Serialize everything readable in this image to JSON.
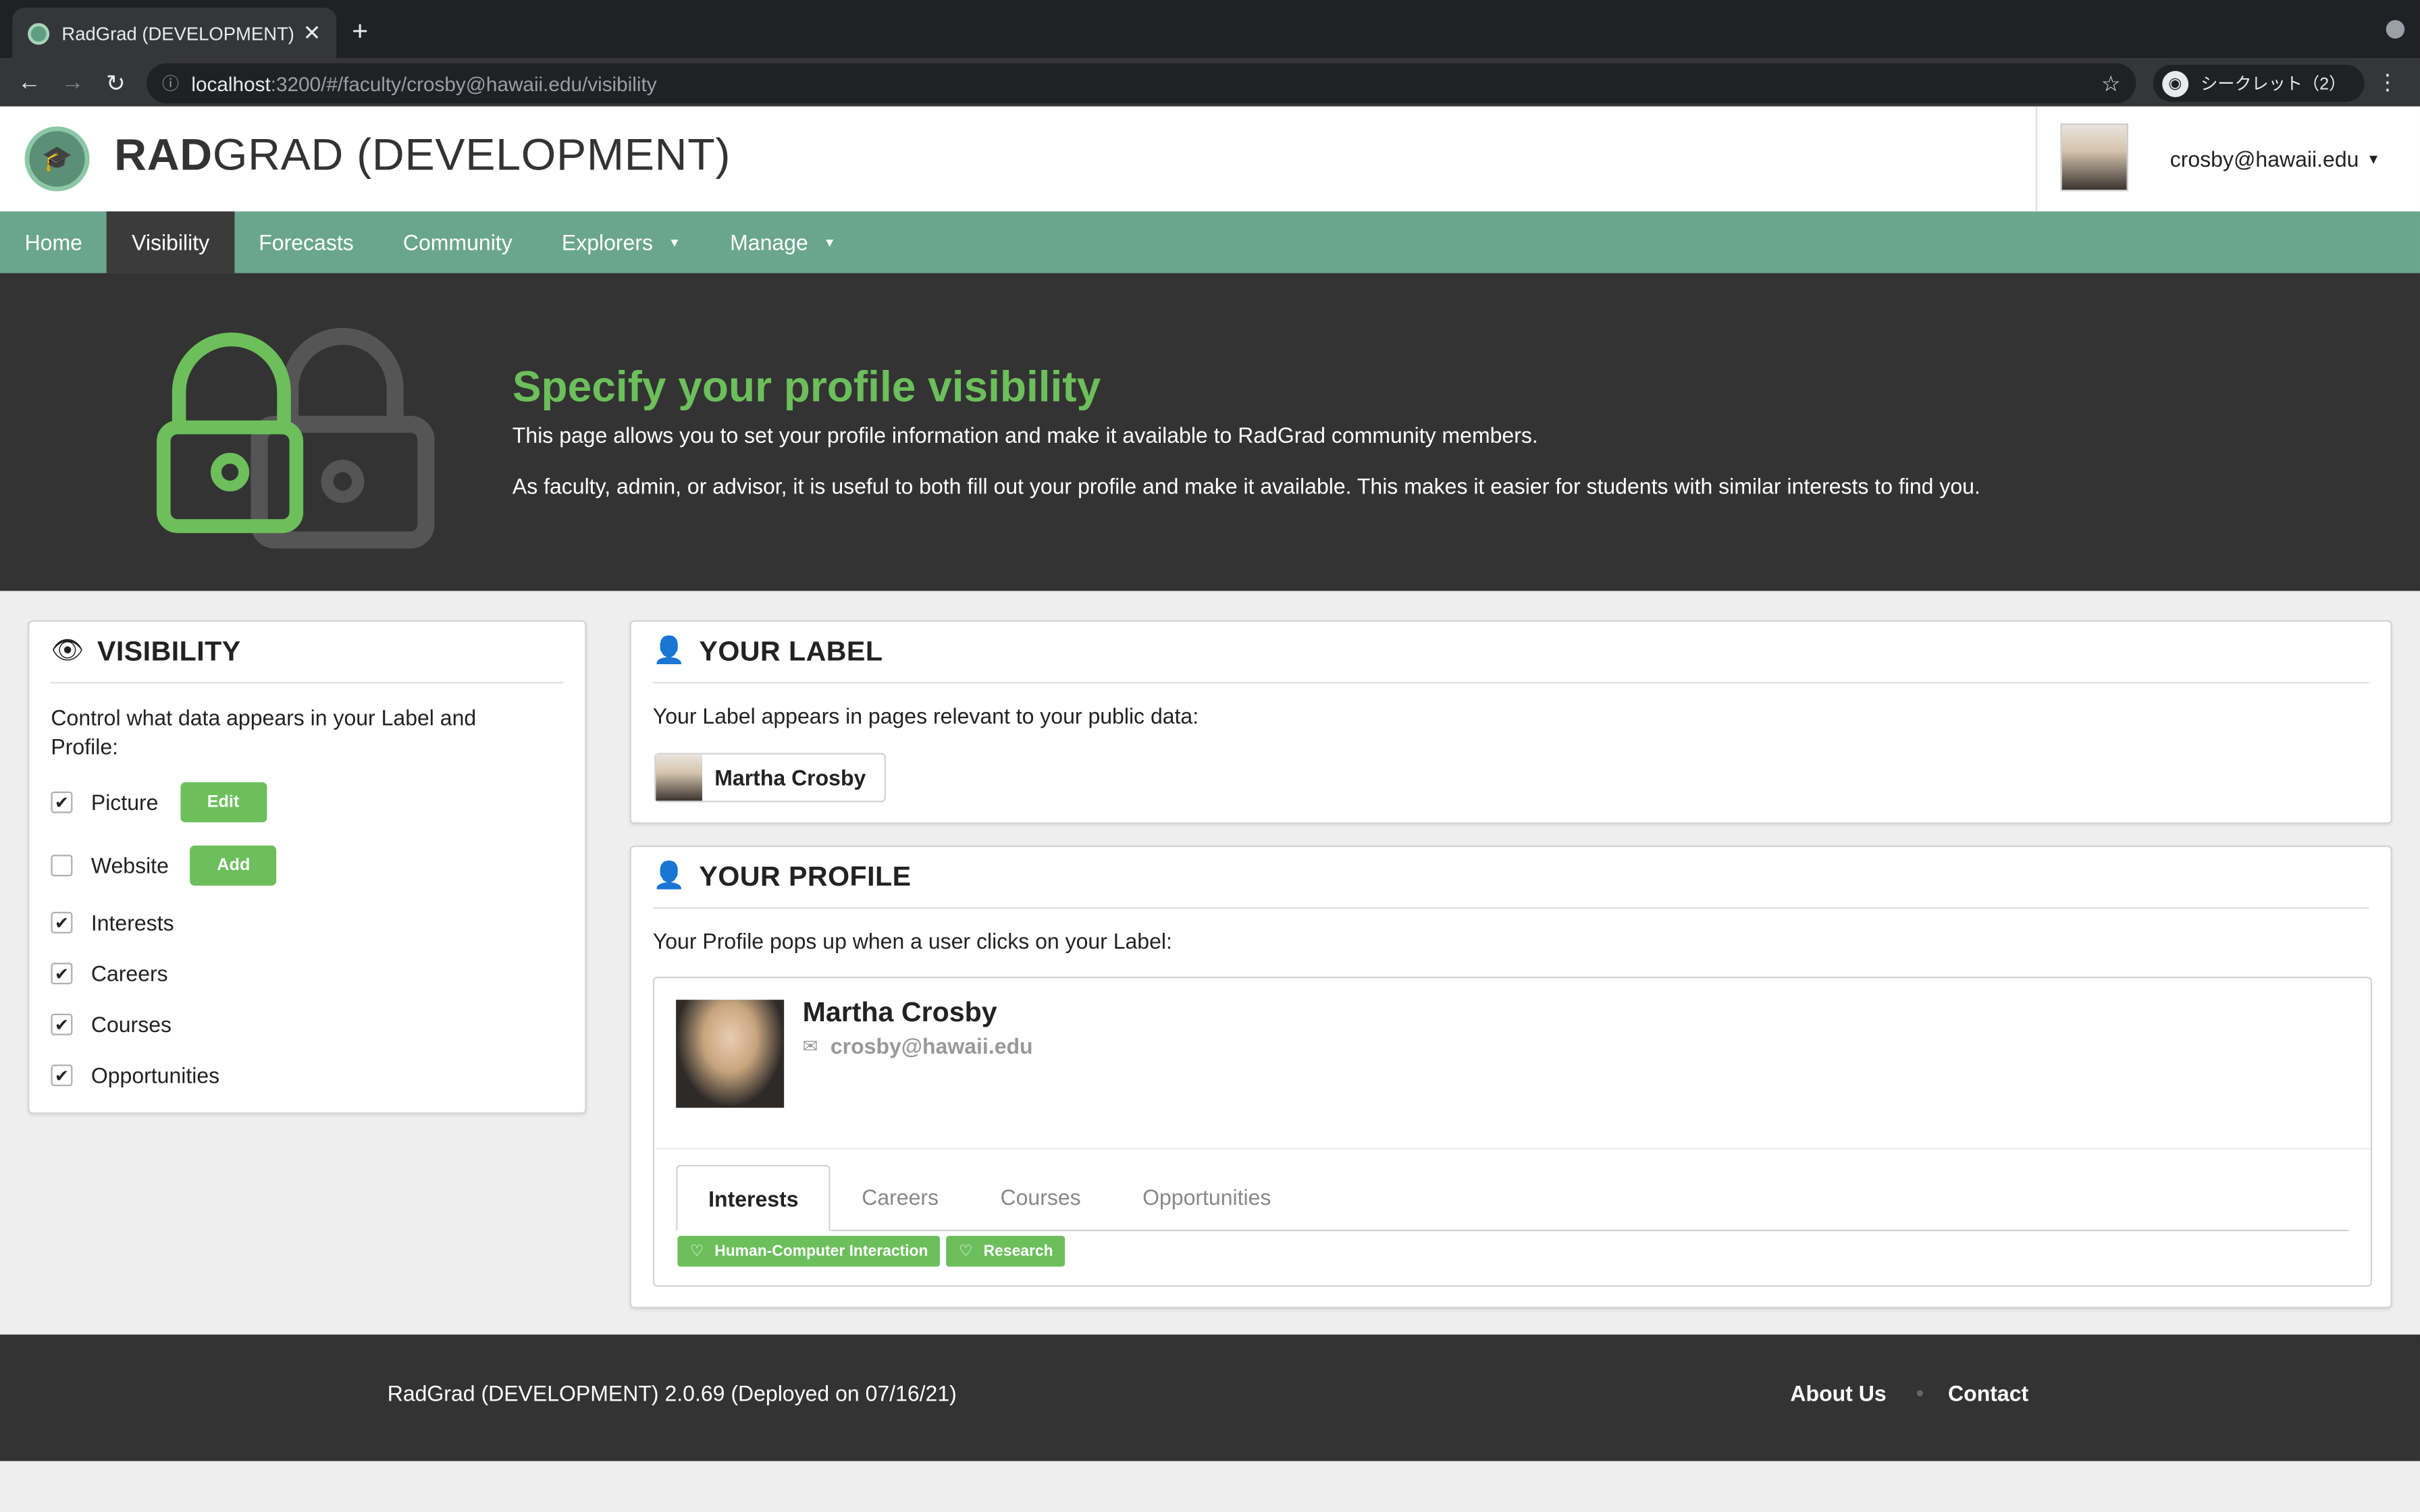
{
  "browser": {
    "tab_title": "RadGrad (DEVELOPMENT)",
    "url_host": "localhost",
    "url_path": ":3200/#/faculty/crosby@hawaii.edu/visibility",
    "incognito_label": "シークレット（2）"
  },
  "header": {
    "brand_strong": "RAD",
    "brand_rest": "GRAD (DEVELOPMENT)",
    "user_email": "crosby@hawaii.edu"
  },
  "nav": {
    "items": [
      "Home",
      "Visibility",
      "Forecasts",
      "Community",
      "Explorers",
      "Manage"
    ],
    "active": "Visibility"
  },
  "hero": {
    "title": "Specify your profile visibility",
    "p1": "This page allows you to set your profile information and make it available to RadGrad community members.",
    "p2": "As faculty, admin, or advisor, it is useful to both fill out your profile and make it available. This makes it easier for students with similar interests to find you."
  },
  "visibility": {
    "title": "VISIBILITY",
    "description": "Control what data appears in your Label and Profile:",
    "items": [
      {
        "label": "Picture",
        "checked": true,
        "button": "Edit"
      },
      {
        "label": "Website",
        "checked": false,
        "button": "Add"
      },
      {
        "label": "Interests",
        "checked": true
      },
      {
        "label": "Careers",
        "checked": true
      },
      {
        "label": "Courses",
        "checked": true
      },
      {
        "label": "Opportunities",
        "checked": true
      }
    ]
  },
  "label_card": {
    "title": "YOUR LABEL",
    "description": "Your Label appears in pages relevant to your public data:",
    "name": "Martha Crosby"
  },
  "profile_card": {
    "title": "YOUR PROFILE",
    "description": "Your Profile pops up when a user clicks on your Label:",
    "name": "Martha Crosby",
    "email": "crosby@hawaii.edu",
    "tabs": [
      "Interests",
      "Careers",
      "Courses",
      "Opportunities"
    ],
    "active_tab": "Interests",
    "tags": [
      "Human-Computer Interaction",
      "Research"
    ]
  },
  "footer": {
    "version": "RadGrad (DEVELOPMENT) 2.0.69 (Deployed on 07/16/21)",
    "about": "About Us",
    "contact": "Contact"
  },
  "colors": {
    "nav_bg": "#6aa68e",
    "accent_green": "#6cbf5b",
    "hero_bg": "#333333"
  }
}
